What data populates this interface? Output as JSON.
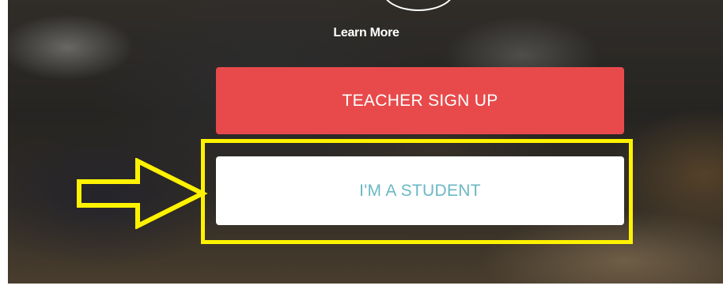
{
  "hero": {
    "learn_more_label": "Learn More"
  },
  "buttons": {
    "teacher_signup_label": "TEACHER SIGN UP",
    "student_label": "I'M A STUDENT"
  },
  "colors": {
    "teacher_button_bg": "#e84a4c",
    "student_button_text": "#6ab8c4",
    "highlight": "#fff200"
  },
  "icons": {
    "top_circle": "play-circle-icon",
    "callout": "arrow-right-icon"
  }
}
